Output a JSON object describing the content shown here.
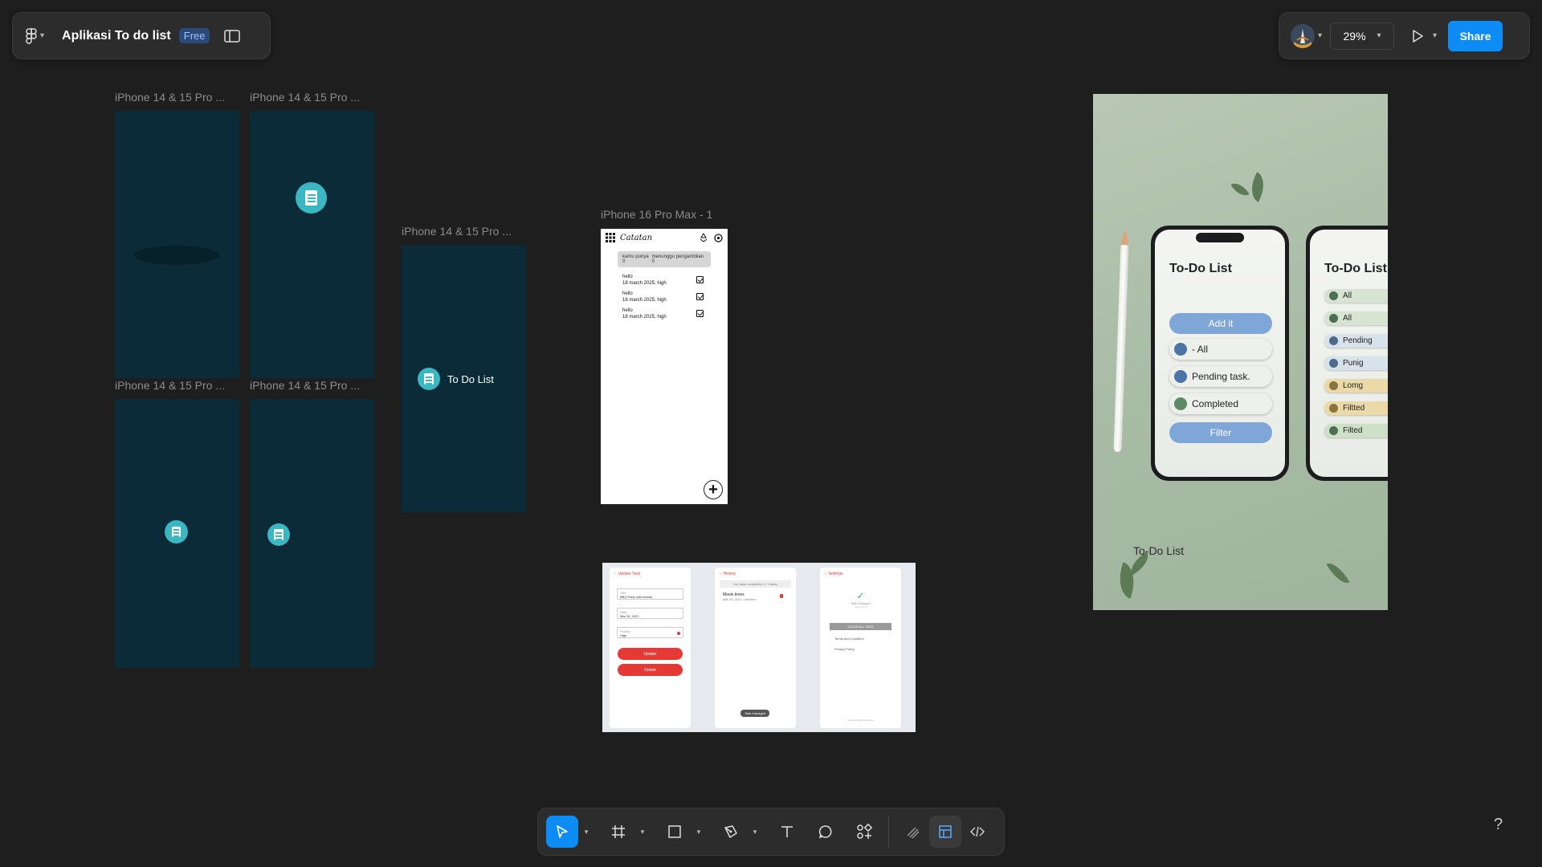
{
  "header": {
    "file_title": "Aplikasi To do list",
    "plan_badge": "Free",
    "zoom_level": "29%",
    "share_label": "Share"
  },
  "icons": {
    "main_menu": "figma-logo-icon",
    "sidebar_toggle": "sidebar-toggle-icon",
    "present": "play-icon",
    "help": "help-question-icon"
  },
  "frames": {
    "iphone_label": "iPhone 14 & 15 Pro ...",
    "catatan_label": "iPhone 16 Pro Max - 1",
    "todo_splash_text": "To Do List"
  },
  "catatan": {
    "title": "Catatan",
    "banner_left": "kamu punya 0",
    "banner_right": "menunggu pengambilan 0",
    "items": [
      {
        "title": "hello",
        "meta": "18 march 2025, high"
      },
      {
        "title": "hello",
        "meta": "18 march 2025, high"
      },
      {
        "title": "hello",
        "meta": "18 march 2025, high"
      }
    ],
    "fab": "+"
  },
  "three_screens": {
    "update": {
      "header": "Update Task",
      "title_label": "Title",
      "title_value": "BBQ Party with friends",
      "date_label": "Date",
      "date_value": "Mar 26, 2021",
      "priority_label": "Priority",
      "priority_value": "High",
      "update_btn": "Update",
      "delete_btn": "Delete"
    },
    "history": {
      "header": "History",
      "banner": "You have completed 1 / 1 tasks",
      "item_title": "Movie times",
      "item_meta": "Mar 26, 2021 • Medium",
      "toast": "Task managed"
    },
    "settings": {
      "header": "Settings",
      "app_name": "Task Manager",
      "version": "Version 1.0",
      "clear_btn": "CLEAR ALL DATA",
      "terms": "Terms and Condition",
      "privacy": "Privacy Policy",
      "footer": "Developed Technologies"
    }
  },
  "mock_image": {
    "title_front": "To-Do List",
    "title_back": "To-Do List",
    "front_add": "Add it",
    "front_items": [
      "- All",
      "Pending task.",
      "Completed"
    ],
    "front_filter": "Filter",
    "back_items": [
      "All",
      "All",
      "Pending",
      "Punig",
      "Lomg",
      "Filtted",
      "Filted"
    ],
    "caption": "To-Do List"
  },
  "toolbar": {
    "tools": [
      "move",
      "frame",
      "shape",
      "pen",
      "text",
      "comment",
      "actions"
    ],
    "modes": [
      "draw",
      "design",
      "dev-mode"
    ]
  },
  "help": "?"
}
